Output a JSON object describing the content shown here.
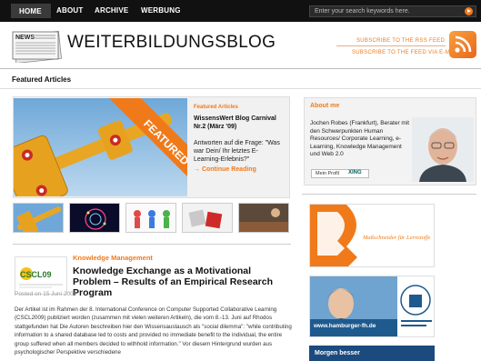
{
  "nav": {
    "items": [
      "HOME",
      "ABOUT",
      "ARCHIVE",
      "WERBUNG"
    ],
    "search_placeholder": "Enter your search keywords here."
  },
  "header": {
    "logo_text": "NEWS",
    "title": "WEITERBILDUNGSBLOG",
    "rss_feed": "SUBSCRIBE TO THE RSS FEED",
    "email_feed": "SUBSCRIBE TO THE FEED VIA E-MAIL"
  },
  "featured": {
    "section_label": "Featured Articles",
    "ribbon": "FEATURED",
    "kicker": "Featured Articles",
    "title": "WissensWert Blog Carnival Nr.2 (März '09)",
    "subtitle": "Antworten auf die Frage: \"Was war Dein/ Ihr letztes E-Learning-Erlebnis?\"",
    "more": "Continue Reading"
  },
  "article": {
    "logo_text": "CSCL09",
    "category": "Knowledge Management",
    "title": "Knowledge Exchange as a Motivational Problem – Results of an Empirical Research Program",
    "date": "Posted on 15 Juni 2009",
    "body": "Der Artikel ist im Rahmen der 8. International Conference on Computer Supported Collaborative Learning (CSCL2009) publiziert worden (zusammen mit vielen weiteren Artikeln), die vom 8.-13. Juni auf Rhodos stattgefunden hat Die Autoren beschreiben hier den Wissensaustausch als \"social dilemma\": \"while contributing information to a shared database led to costs and provided no immediate benefit to the individual, the entire group suffered when all members decided to withhold information.\" Vor diesem Hintergrund wurden aus psychologischer Perspektive verschiedene"
  },
  "sidebar": {
    "about_title": "About me",
    "about_text": "Jochen Robes (Frankfurt), Berater mit den Schwerpunkten Human Resources/ Corporate Learning, e-Learning, Knowledge Management und Web 2.0",
    "profile_label": "Mein Profil",
    "xing": "XING",
    "ad1_text": "Maßschneider für Lernstoffe",
    "ad2_url": "www.hamburger-fh.de",
    "ad3_text": "Morgen besser"
  },
  "colors": {
    "accent": "#f07a1a",
    "nav_bg": "#111111"
  }
}
